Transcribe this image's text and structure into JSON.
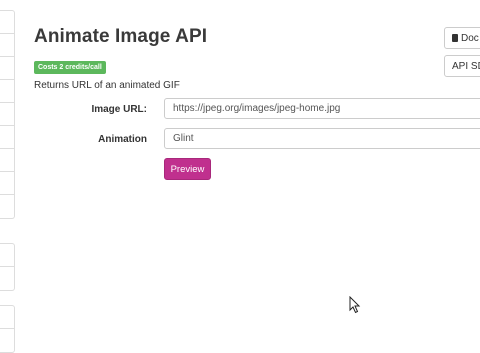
{
  "page": {
    "title": "Animate Image API",
    "badge": "Costs 2 credits/call",
    "description": "Returns URL of an animated GIF"
  },
  "form": {
    "image_url_label": "Image URL:",
    "image_url_value": "https://jpeg.org/images/jpeg-home.jpg",
    "animation_label": "Animation",
    "animation_value": "Glint",
    "preview_label": "Preview"
  },
  "toolbar": {
    "docs_label": "Doc",
    "api_sdk_label": "API SD"
  },
  "colors": {
    "badge": "#5cb85c",
    "preview_button": "#c0308e"
  }
}
